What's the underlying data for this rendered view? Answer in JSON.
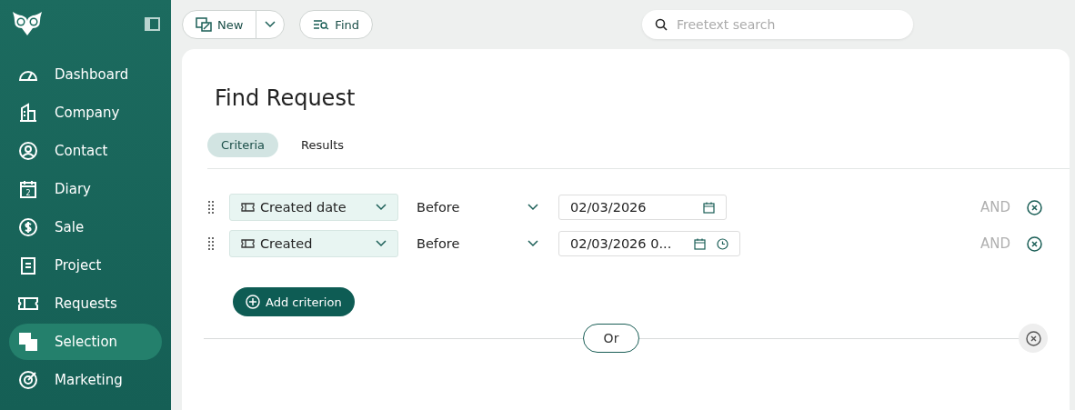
{
  "sidebar": {
    "items": [
      {
        "label": "Dashboard",
        "selected": false
      },
      {
        "label": "Company",
        "selected": false
      },
      {
        "label": "Contact",
        "selected": false
      },
      {
        "label": "Diary",
        "selected": false
      },
      {
        "label": "Sale",
        "selected": false
      },
      {
        "label": "Project",
        "selected": false
      },
      {
        "label": "Requests",
        "selected": false
      },
      {
        "label": "Selection",
        "selected": true
      },
      {
        "label": "Marketing",
        "selected": false
      }
    ],
    "diary_day": "2"
  },
  "toolbar": {
    "new_button": "New",
    "find_button": "Find",
    "search": {
      "placeholder": "Freetext search"
    }
  },
  "page": {
    "title": "Find Request",
    "tabs": [
      {
        "label": "Criteria",
        "selected": true
      },
      {
        "label": "Results",
        "selected": false
      }
    ],
    "criteria": [
      {
        "field": "Created date",
        "operator": "Before",
        "value": "02/03/2026",
        "kind": "date",
        "joiner": "AND"
      },
      {
        "field": "Created",
        "operator": "Before",
        "value": "02/03/2026 0...",
        "kind": "datetime",
        "joiner": "AND"
      }
    ],
    "add_button": "Add criterion",
    "or_button": "Or"
  }
}
